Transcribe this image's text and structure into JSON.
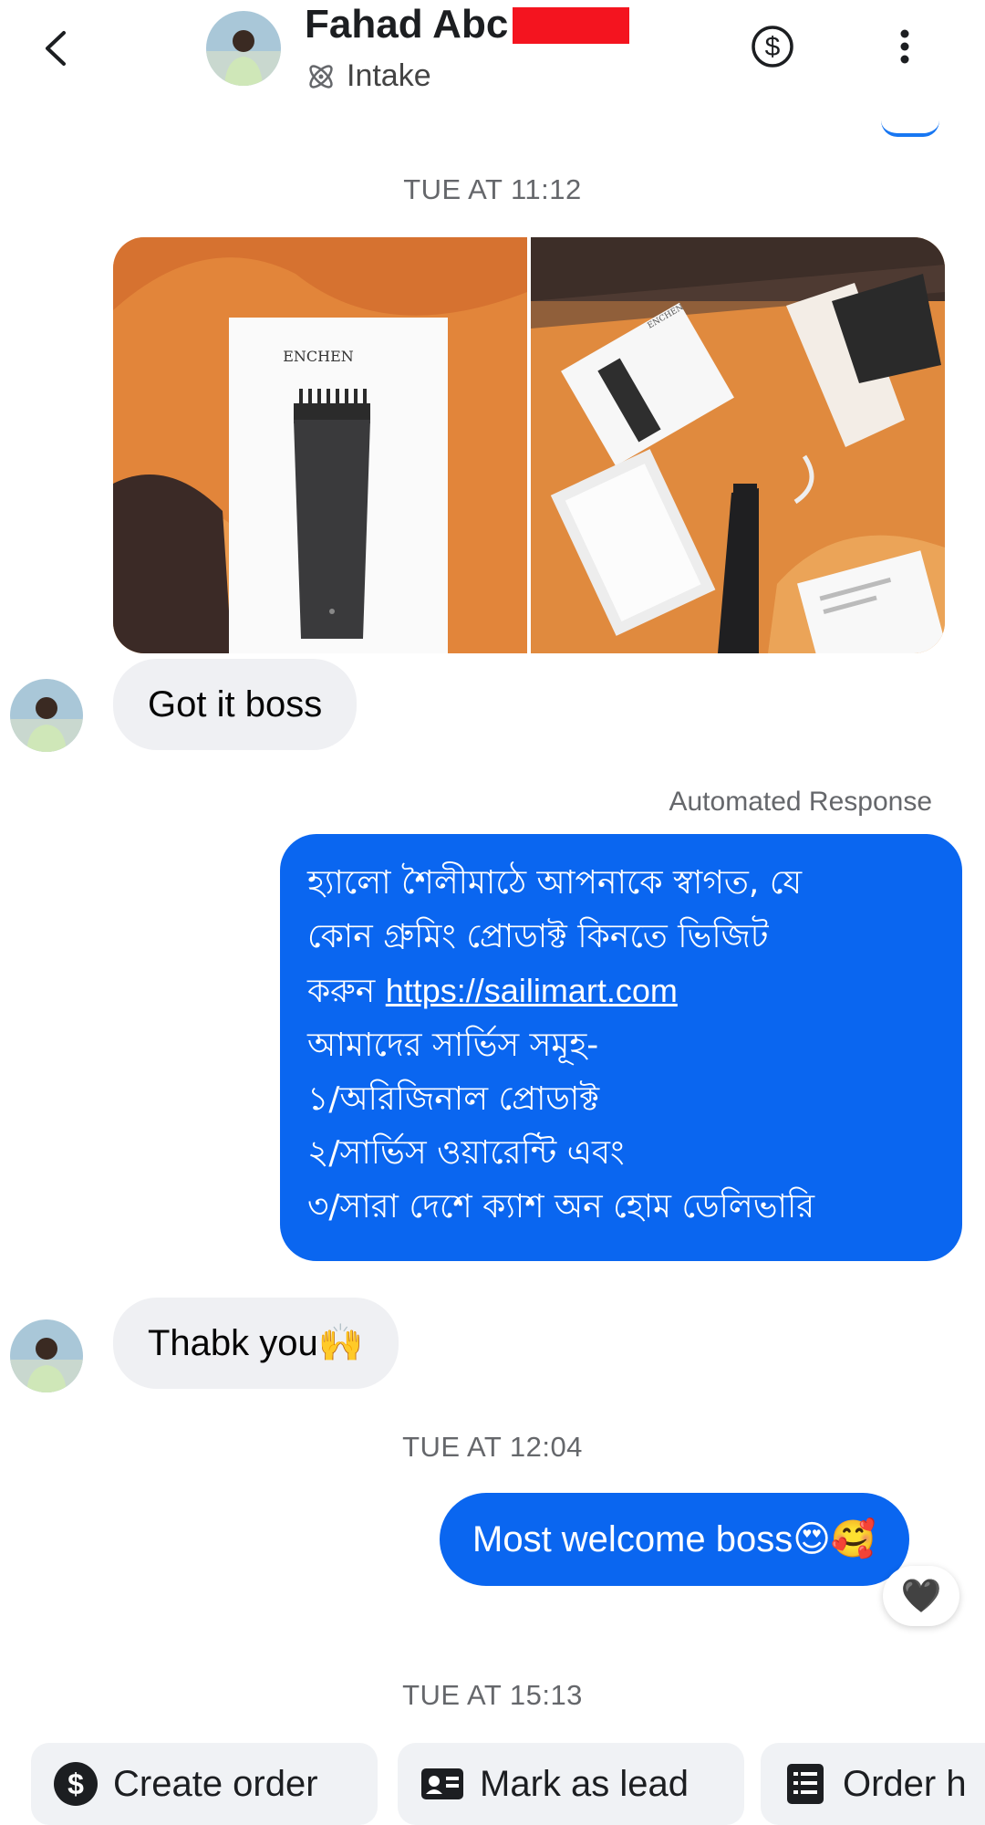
{
  "header": {
    "contact_name": "Fahad Abc",
    "status_label": "Intake",
    "icons": {
      "back": "chevron-left-icon",
      "payment": "dollar-circle-icon",
      "more": "more-vertical-icon",
      "status": "atom-icon"
    }
  },
  "thread": {
    "timestamp_1": "TUE AT 11:12",
    "photos": [
      "ENCHEN",
      "ENCHEN"
    ],
    "msg_got_it": "Got it boss",
    "automated_label": "Automated Response",
    "automated_lines": [
      "হ্যালো  শৈলীমাঠে আপনাকে স্বাগত, যে",
      "কোন গ্রুমিং প্রোডাক্ট কিনতে ভিজিট",
      "করুন",
      "আমাদের সার্ভিস সমূহ-",
      "১/অরিজিনাল প্রোডাক্ট",
      "২/সার্ভিস ওয়ারেন্টি এবং",
      "৩/সারা দেশে ক্যাশ অন হোম ডেলিভারি"
    ],
    "automated_link": "https://sailimart.com",
    "msg_thank_you": "Thabk you🙌",
    "timestamp_2": "TUE AT 12:04",
    "msg_welcome": "Most welcome boss😍🥰",
    "reaction": "🖤",
    "timestamp_3": "TUE AT 15:13"
  },
  "actions": {
    "create_order": "Create order",
    "mark_as_lead": "Mark as lead",
    "order_history": "Order h"
  },
  "colors": {
    "accent": "#0a66f0",
    "incoming_bubble": "#eff0f3",
    "muted_text": "#65676b"
  }
}
